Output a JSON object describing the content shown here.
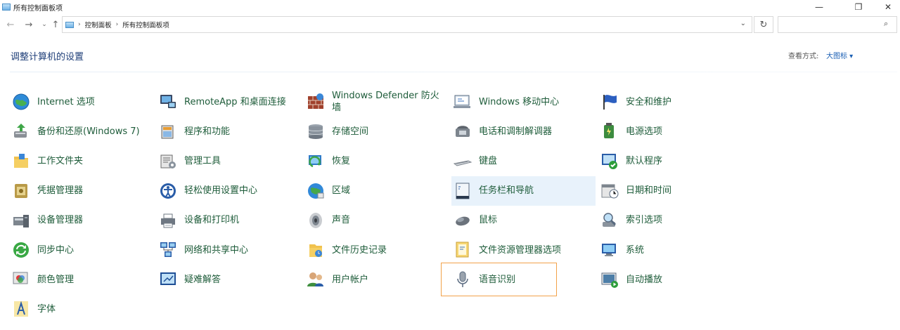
{
  "window": {
    "title": "所有控制面板项"
  },
  "controls": {
    "minimize": "—",
    "maximize": "❐",
    "close": "✕"
  },
  "nav": {
    "back": "←",
    "forward": "→",
    "recent": "⌄",
    "up": "↑",
    "dropdown": "⌄",
    "refresh": "↻",
    "search_glyph": "⌕"
  },
  "breadcrumb": [
    "控制面板",
    "所有控制面板项"
  ],
  "search": {
    "placeholder": ""
  },
  "header": {
    "title": "调整计算机的设置",
    "view_label": "查看方式:",
    "view_value": "大图标 ▾"
  },
  "colors": {
    "link": "#1e5c3a",
    "title": "#1e3e78",
    "hover": "#e8f2fb",
    "selection": "#f2a24a",
    "accent": "#1a5fb4"
  },
  "items": [
    {
      "label": "Internet 选项",
      "icon": "globe-icon"
    },
    {
      "label": "RemoteApp 和桌面连接",
      "icon": "remote-desktop-icon"
    },
    {
      "label": "Windows Defender 防火墙",
      "icon": "firewall-icon"
    },
    {
      "label": "Windows 移动中心",
      "icon": "mobility-center-icon"
    },
    {
      "label": "安全和维护",
      "icon": "security-flag-icon"
    },
    {
      "label": "备份和还原(Windows 7)",
      "icon": "backup-icon"
    },
    {
      "label": "程序和功能",
      "icon": "programs-icon"
    },
    {
      "label": "存储空间",
      "icon": "storage-icon"
    },
    {
      "label": "电话和调制解调器",
      "icon": "phone-modem-icon"
    },
    {
      "label": "电源选项",
      "icon": "power-icon"
    },
    {
      "label": "工作文件夹",
      "icon": "work-folder-icon"
    },
    {
      "label": "管理工具",
      "icon": "admin-tools-icon"
    },
    {
      "label": "恢复",
      "icon": "recovery-icon"
    },
    {
      "label": "键盘",
      "icon": "keyboard-icon"
    },
    {
      "label": "默认程序",
      "icon": "default-programs-icon"
    },
    {
      "label": "凭据管理器",
      "icon": "credential-icon"
    },
    {
      "label": "轻松使用设置中心",
      "icon": "ease-of-access-icon"
    },
    {
      "label": "区域",
      "icon": "region-globe-icon"
    },
    {
      "label": "任务栏和导航",
      "icon": "taskbar-icon"
    },
    {
      "label": "日期和时间",
      "icon": "date-time-icon"
    },
    {
      "label": "设备管理器",
      "icon": "device-manager-icon"
    },
    {
      "label": "设备和打印机",
      "icon": "printer-icon"
    },
    {
      "label": "声音",
      "icon": "speaker-icon"
    },
    {
      "label": "鼠标",
      "icon": "mouse-icon"
    },
    {
      "label": "索引选项",
      "icon": "indexing-icon"
    },
    {
      "label": "同步中心",
      "icon": "sync-icon"
    },
    {
      "label": "网络和共享中心",
      "icon": "network-icon"
    },
    {
      "label": "文件历史记录",
      "icon": "file-history-icon"
    },
    {
      "label": "文件资源管理器选项",
      "icon": "folder-options-icon"
    },
    {
      "label": "系统",
      "icon": "system-icon"
    },
    {
      "label": "颜色管理",
      "icon": "color-management-icon"
    },
    {
      "label": "疑难解答",
      "icon": "troubleshooting-icon"
    },
    {
      "label": "用户帐户",
      "icon": "user-accounts-icon"
    },
    {
      "label": "语音识别",
      "icon": "microphone-icon"
    },
    {
      "label": "自动播放",
      "icon": "autoplay-icon"
    },
    {
      "label": "字体",
      "icon": "fonts-icon"
    }
  ]
}
